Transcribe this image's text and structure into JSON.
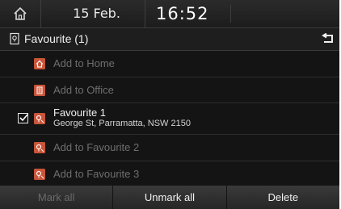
{
  "status": {
    "date": "15 Feb.",
    "time": "16:52"
  },
  "header": {
    "title": "Favourite (1)"
  },
  "list": {
    "add_home": "Add to Home",
    "add_office": "Add to Office",
    "favourite_1": {
      "name": "Favourite 1",
      "address": "George St, Parramatta, NSW 2150",
      "checked": true
    },
    "add_fav_2": "Add to Favourite 2",
    "add_fav_3": "Add to Favourite 3"
  },
  "footer": {
    "mark_all": "Mark all",
    "unmark_all": "Unmark all",
    "delete": "Delete"
  },
  "colors": {
    "pin": "#c8553a",
    "background": "#141414",
    "disabled_text": "#6e6e6e"
  }
}
